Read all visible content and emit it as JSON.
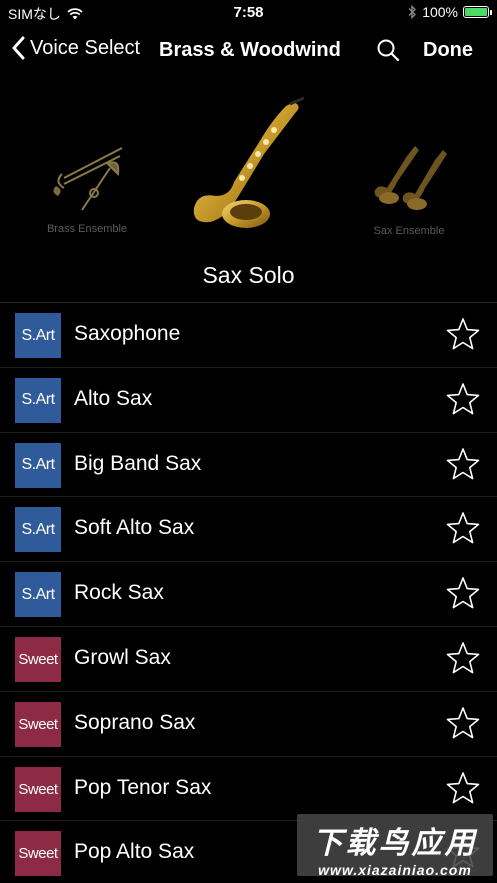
{
  "status_bar": {
    "carrier": "SIMなし",
    "time": "7:58",
    "battery_percent": "100%",
    "battery_level": 1.0
  },
  "nav": {
    "back_label": "Voice Select",
    "title": "Brass & Woodwind",
    "done_label": "Done"
  },
  "carousel": {
    "left_caption": "Brass Ensemble",
    "right_caption": "Sax Ensemble",
    "current_voice": "Sax Solo"
  },
  "voices": [
    {
      "badge": "S.Art",
      "badge_type": "sart",
      "name": "Saxophone",
      "favorite": false
    },
    {
      "badge": "S.Art",
      "badge_type": "sart",
      "name": "Alto Sax",
      "favorite": false
    },
    {
      "badge": "S.Art",
      "badge_type": "sart",
      "name": "Big Band Sax",
      "favorite": false
    },
    {
      "badge": "S.Art",
      "badge_type": "sart",
      "name": "Soft Alto Sax",
      "favorite": false
    },
    {
      "badge": "S.Art",
      "badge_type": "sart",
      "name": "Rock Sax",
      "favorite": false
    },
    {
      "badge": "Sweet",
      "badge_type": "sweet",
      "name": "Growl Sax",
      "favorite": false
    },
    {
      "badge": "Sweet",
      "badge_type": "sweet",
      "name": "Soprano Sax",
      "favorite": false
    },
    {
      "badge": "Sweet",
      "badge_type": "sweet",
      "name": "Pop Tenor Sax",
      "favorite": false
    },
    {
      "badge": "Sweet",
      "badge_type": "sweet",
      "name": "Pop Alto Sax",
      "favorite": false
    }
  ],
  "watermark": {
    "top": "下载鸟应用",
    "bottom": "www.xiazainiao.com"
  },
  "colors": {
    "background": "#000000",
    "sart_badge": "#2f5b9a",
    "sweet_badge": "#8d2a45",
    "battery": "#4cd964"
  }
}
